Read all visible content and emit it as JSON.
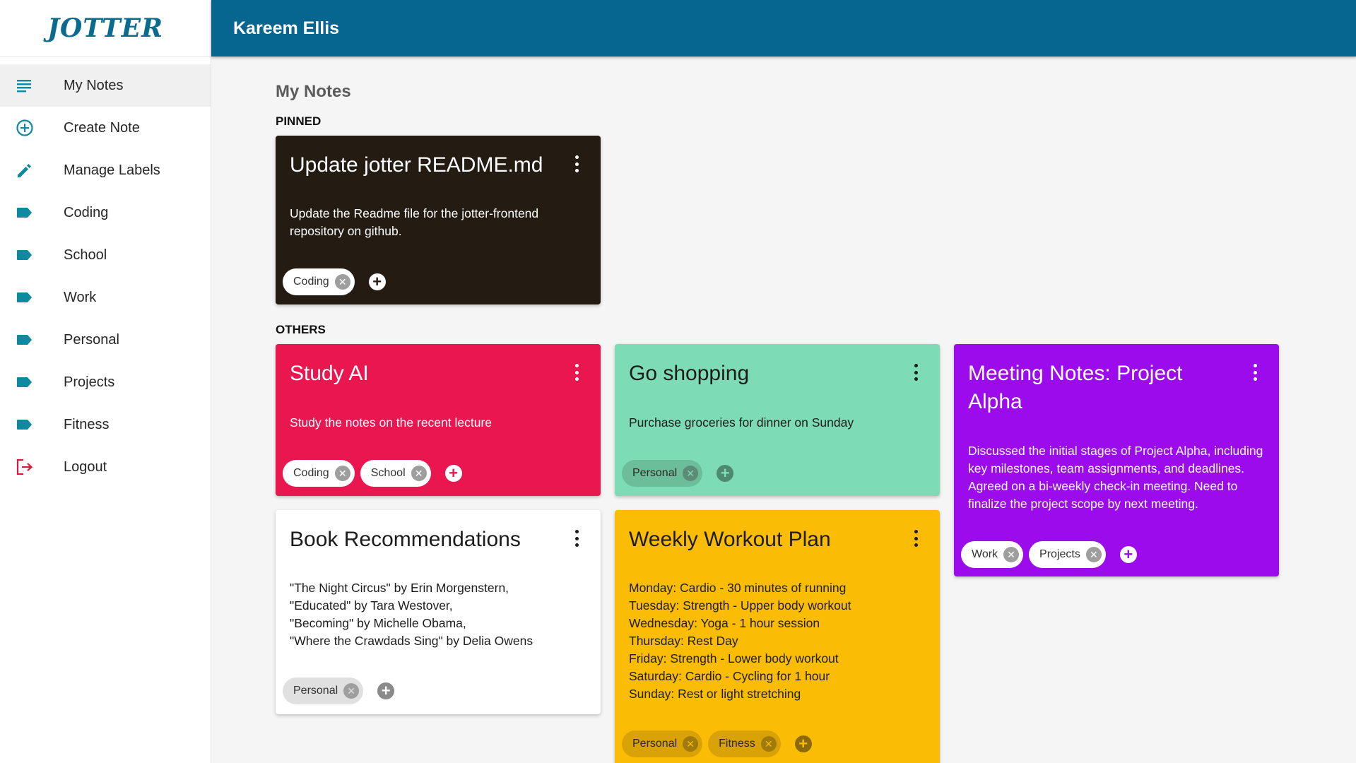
{
  "app": {
    "logo": "JOTTER",
    "user_name": "Kareem Ellis"
  },
  "sidebar": {
    "items": [
      {
        "label": "My Notes",
        "icon": "notes-list-icon"
      },
      {
        "label": "Create Note",
        "icon": "plus-circle-icon"
      },
      {
        "label": "Manage Labels",
        "icon": "pencil-icon"
      },
      {
        "label": "Coding",
        "icon": "label-icon"
      },
      {
        "label": "School",
        "icon": "label-icon"
      },
      {
        "label": "Work",
        "icon": "label-icon"
      },
      {
        "label": "Personal",
        "icon": "label-icon"
      },
      {
        "label": "Projects",
        "icon": "label-icon"
      },
      {
        "label": "Fitness",
        "icon": "label-icon"
      },
      {
        "label": "Logout",
        "icon": "logout-icon"
      }
    ],
    "active": "My Notes",
    "icon_color": "#0b8aa0"
  },
  "main": {
    "title": "My Notes",
    "pinned_label": "PINNED",
    "others_label": "OTHERS",
    "pinned": [
      {
        "title": "Update jotter README.md",
        "body": "Update the Readme file for the jotter-frontend repository on github.",
        "color": "#241b13",
        "labels": [
          "Coding"
        ]
      }
    ],
    "others": [
      {
        "title": "Study AI",
        "body": "Study the notes on the recent lecture",
        "color": "#ea1650",
        "labels": [
          "Coding",
          "School"
        ]
      },
      {
        "title": "Go shopping",
        "body": "Purchase groceries for dinner on Sunday",
        "color": "#7ddcb5",
        "labels": [
          "Personal"
        ]
      },
      {
        "title": "Meeting Notes: Project Alpha",
        "body": "Discussed the initial stages of Project Alpha, including key milestones, team assignments, and deadlines. Agreed on a bi-weekly check-in meeting. Need to finalize the project scope by next meeting.",
        "color": "#9c0bec",
        "labels": [
          "Work",
          "Projects"
        ]
      },
      {
        "title": "Book Recommendations",
        "body": "\"The Night Circus\" by Erin Morgenstern,\n\"Educated\" by Tara Westover,\n\"Becoming\" by Michelle Obama,\n\"Where the Crawdads Sing\" by Delia Owens",
        "color": "#ffffff",
        "labels": [
          "Personal"
        ]
      },
      {
        "title": "Weekly Workout Plan",
        "body": "Monday: Cardio - 30 minutes of running\nTuesday: Strength - Upper body workout\nWednesday: Yoga - 1 hour session\nThursday: Rest Day\nFriday: Strength - Lower body workout\nSaturday: Cardio - Cycling for 1 hour\nSunday: Rest or light stretching",
        "color": "#fbbc05",
        "labels": [
          "Personal",
          "Fitness"
        ]
      }
    ]
  }
}
